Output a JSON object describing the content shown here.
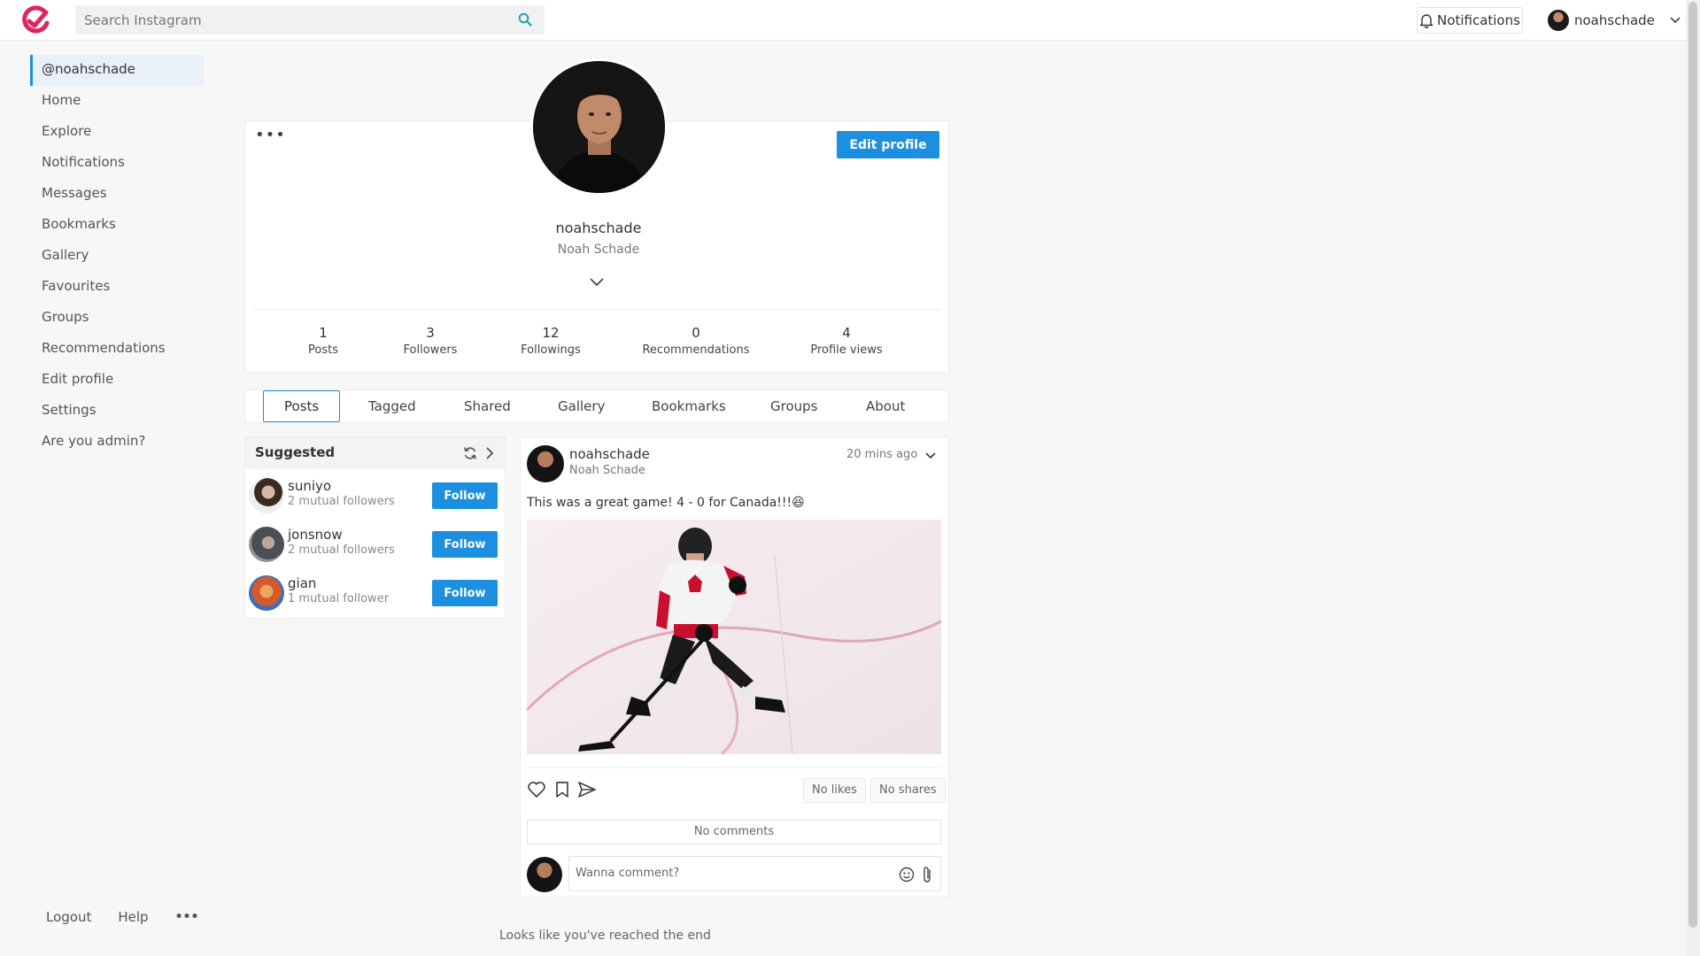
{
  "topbar": {
    "search_placeholder": "Search Instagram",
    "notifications_label": "Notifications",
    "username": "noahschade"
  },
  "sidebar": {
    "items": [
      {
        "label": "@noahschade",
        "active": true
      },
      {
        "label": "Home"
      },
      {
        "label": "Explore"
      },
      {
        "label": "Notifications"
      },
      {
        "label": "Messages"
      },
      {
        "label": "Bookmarks"
      },
      {
        "label": "Gallery"
      },
      {
        "label": "Favourites"
      },
      {
        "label": "Groups"
      },
      {
        "label": "Recommendations"
      },
      {
        "label": "Edit profile"
      },
      {
        "label": "Settings"
      },
      {
        "label": "Are you admin?"
      }
    ],
    "footer": {
      "logout": "Logout",
      "help": "Help",
      "more": "•••"
    }
  },
  "profile": {
    "more": "•••",
    "edit_label": "Edit profile",
    "username": "noahschade",
    "full_name": "Noah Schade",
    "stats": [
      {
        "value": "1",
        "label": "Posts"
      },
      {
        "value": "3",
        "label": "Followers"
      },
      {
        "value": "12",
        "label": "Followings"
      },
      {
        "value": "0",
        "label": "Recommendations"
      },
      {
        "value": "4",
        "label": "Profile views"
      }
    ]
  },
  "tabs": [
    {
      "label": "Posts",
      "active": true
    },
    {
      "label": "Tagged"
    },
    {
      "label": "Shared"
    },
    {
      "label": "Gallery"
    },
    {
      "label": "Bookmarks"
    },
    {
      "label": "Groups"
    },
    {
      "label": "About"
    }
  ],
  "suggested": {
    "title": "Suggested",
    "follow_label": "Follow",
    "users": [
      {
        "name": "suniyo",
        "mutual": "2 mutual followers"
      },
      {
        "name": "jonsnow",
        "mutual": "2 mutual followers"
      },
      {
        "name": "gian",
        "mutual": "1 mutual follower"
      }
    ]
  },
  "post": {
    "username": "noahschade",
    "full_name": "Noah Schade",
    "time": "20 mins ago",
    "text": "This was a great game! 4 - 0 for Canada!!!😆",
    "likes": "No likes",
    "shares": "No shares",
    "comments": "No comments",
    "comment_placeholder": "Wanna comment?"
  },
  "footer_text": "Looks like you've reached the end",
  "colors": {
    "accent": "#1d8fe1",
    "brand": "#e0245e"
  }
}
